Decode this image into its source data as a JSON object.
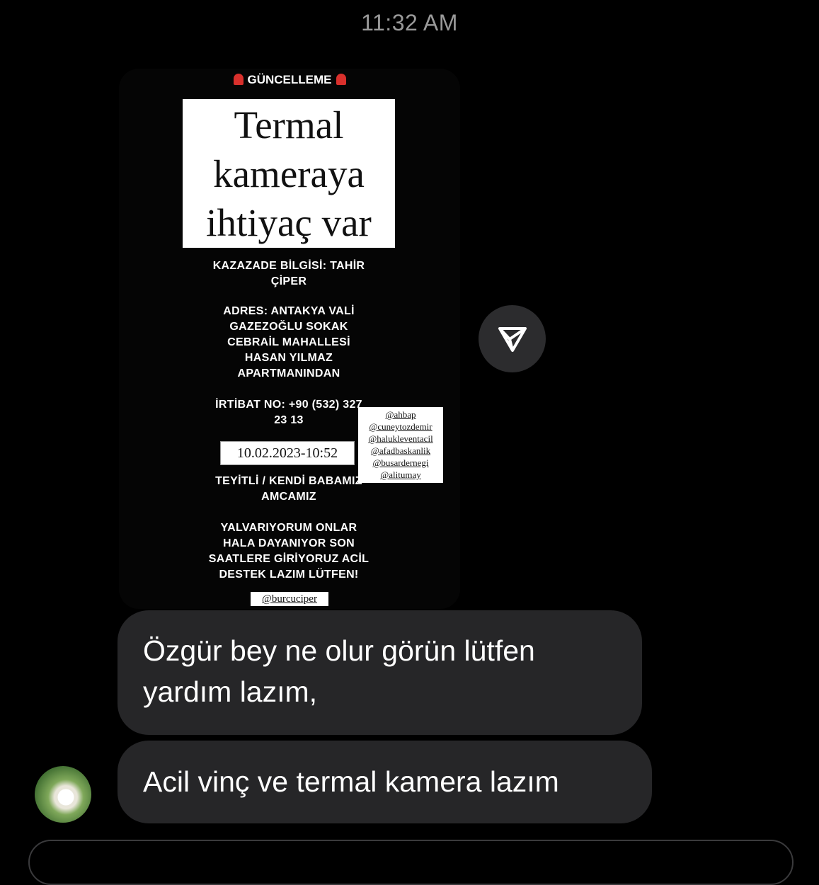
{
  "status": {
    "time": "11:32 AM"
  },
  "story": {
    "update_label": "GÜNCELLEME",
    "headline": [
      "Termal",
      "kameraya",
      "ihtiyaç var"
    ],
    "victim_info": "KAZAZADE BİLGİSİ: TAHİR\nÇİPER",
    "address": "ADRES: ANTAKYA VALİ\nGAZEZOĞLU SOKAK\nCEBRAİL MAHALLESİ\nHASAN YILMAZ\nAPARTMANINDAN",
    "contact": "İRTİBAT NO: +90 (532) 327\n23 13",
    "date": "10.02.2023-10:52",
    "verified": "TEYİTLİ / KENDİ BABAMIZ\nAMCAMIZ",
    "plea": "YALVARIYORUM ONLAR\nHALA DAYANIYOR SON\nSAATLERE GİRİYORUZ ACİL\nDESTEK LAZIM LÜTFEN!",
    "mentions": [
      "@ahbap",
      "@cuneytozdemir",
      "@halukleventacil",
      "@afadbaskanlik",
      "@busardernegi",
      "@alitumay"
    ],
    "handle": "@burcuciper"
  },
  "messages": [
    {
      "text": "Özgür bey ne olur görün lütfen yardım lazım,"
    },
    {
      "text": "Acil vinç ve termal kamera lazım"
    }
  ],
  "icons": {
    "share": "send-paper-plane-icon",
    "siren": "siren-icon",
    "avatar": "user-avatar"
  }
}
